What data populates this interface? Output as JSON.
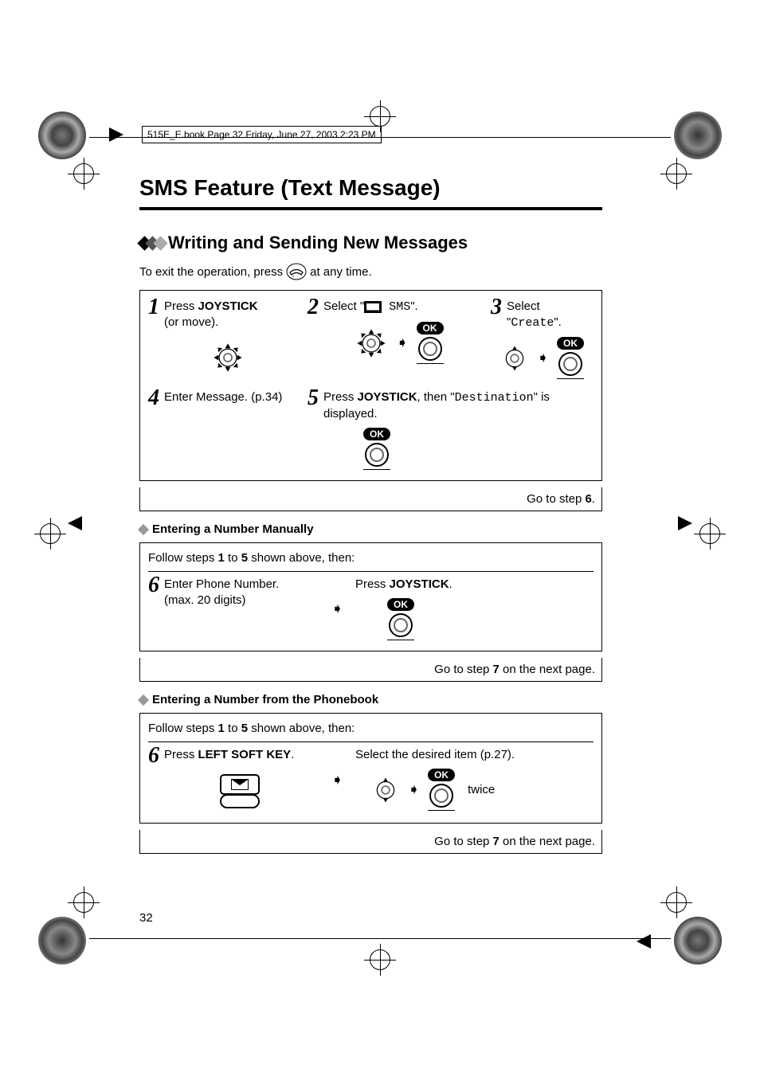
{
  "header": "515E_E.book  Page 32  Friday, June 27, 2003  2:23 PM",
  "title": "SMS Feature (Text Message)",
  "section": "Writing and Sending New Messages",
  "intro_1": "To exit the operation, press ",
  "intro_2": " at any time.",
  "steps": {
    "s1": {
      "num": "1",
      "t1": "Press ",
      "b1": "JOYSTICK",
      "t2": " (or move)."
    },
    "s2": {
      "num": "2",
      "t1": "Select \"",
      "mono": " SMS",
      "t2": "\"."
    },
    "s3": {
      "num": "3",
      "t1": "Select \"",
      "mono": "Create",
      "t2": "\"."
    },
    "s4": {
      "num": "4",
      "t1": "Enter Message. (p.34)"
    },
    "s5": {
      "num": "5",
      "t1": "Press ",
      "b1": "JOYSTICK",
      "t2": ", then \"",
      "mono": "Destination",
      "t3": "\" is displayed."
    }
  },
  "goto1": {
    "pre": "Go to step ",
    "b": "6",
    "post": "."
  },
  "sub1": {
    "title": "Entering a Number Manually",
    "follow_pre": "Follow steps ",
    "b1": "1",
    "mid": " to ",
    "b2": "5",
    "post": " shown above, then:",
    "s6": {
      "num": "6",
      "t1": "Enter Phone Number.",
      "t2": "(max. 20 digits)"
    },
    "s6b": {
      "t1": "Press ",
      "b1": "JOYSTICK",
      "t2": "."
    },
    "goto": {
      "pre": "Go to step ",
      "b": "7",
      "post": " on the next page."
    }
  },
  "sub2": {
    "title": "Entering a Number from the Phonebook",
    "follow_pre": "Follow steps ",
    "b1": "1",
    "mid": " to ",
    "b2": "5",
    "post": " shown above, then:",
    "s6": {
      "num": "6",
      "t1": "Press ",
      "b1": "LEFT SOFT KEY",
      "t2": "."
    },
    "s6b": "Select the desired item (p.27).",
    "twice": "twice",
    "goto": {
      "pre": "Go to step ",
      "b": "7",
      "post": " on the next page."
    }
  },
  "ok": "OK",
  "page_num": "32"
}
